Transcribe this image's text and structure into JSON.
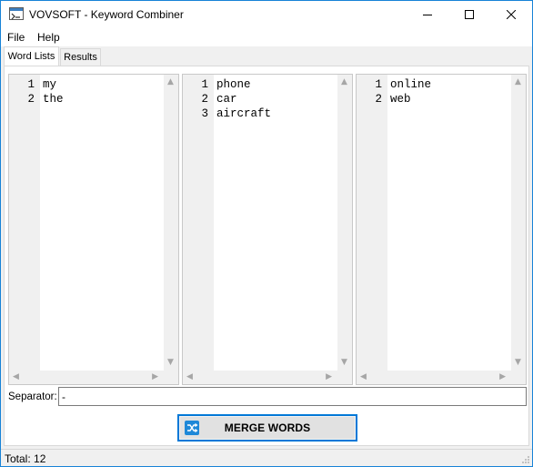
{
  "window": {
    "title": "VOVSOFT - Keyword Combiner",
    "accent": "#0078d7"
  },
  "menu": {
    "file": "File",
    "help": "Help"
  },
  "tabs": [
    {
      "label": "Word Lists",
      "active": true
    },
    {
      "label": "Results",
      "active": false
    }
  ],
  "lists": [
    {
      "lines": [
        "my",
        "the"
      ]
    },
    {
      "lines": [
        "phone",
        "car",
        "aircraft"
      ]
    },
    {
      "lines": [
        "online",
        "web"
      ]
    }
  ],
  "separator": {
    "label": "Separator:",
    "value": "-"
  },
  "merge_button": {
    "label": "MERGE WORDS",
    "icon": "shuffle-icon"
  },
  "status": {
    "text": "Total: 12"
  }
}
